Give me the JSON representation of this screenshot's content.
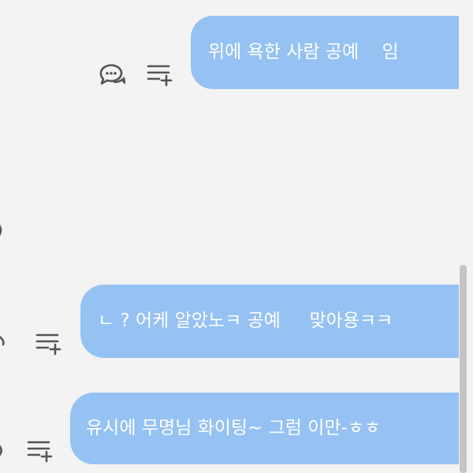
{
  "messages": [
    {
      "text": "위에 욕한 사람 공예    임"
    },
    {
      "text": "ㄴ ? 어케 알았노ㅋ 공예     맞아용ㅋㅋ"
    },
    {
      "text": "유시에 무명님 화이팅~ 그럼 이만-ㅎㅎ"
    }
  ],
  "icons": {
    "reply": "comment-bubbles-icon",
    "menu": "add-to-list-icon"
  },
  "colors": {
    "background": "#f3f3f3",
    "bubble": "#95c1f3",
    "bubble_text": "#ffffff",
    "icon": "#555555",
    "scrollbar": "#c4c4c4"
  }
}
